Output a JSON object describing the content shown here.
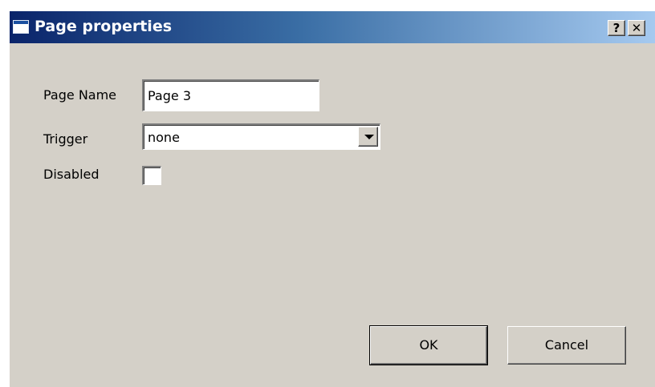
{
  "window": {
    "title": "Page properties",
    "help_glyph": "?",
    "close_glyph": "✕"
  },
  "form": {
    "page_name_label": "Page Name",
    "page_name_value": "Page 3",
    "trigger_label": "Trigger",
    "trigger_value": "none",
    "disabled_label": "Disabled",
    "disabled_checked": false
  },
  "buttons": {
    "ok_label": "OK",
    "cancel_label": "Cancel"
  },
  "colors": {
    "titlebar_start": "#0a246a",
    "titlebar_end": "#a6caf0",
    "dialog_bg": "#d4d0c8"
  },
  "icons": {
    "app": "window-icon",
    "help": "help-icon",
    "close": "close-icon",
    "dropdown": "chevron-down-icon"
  }
}
